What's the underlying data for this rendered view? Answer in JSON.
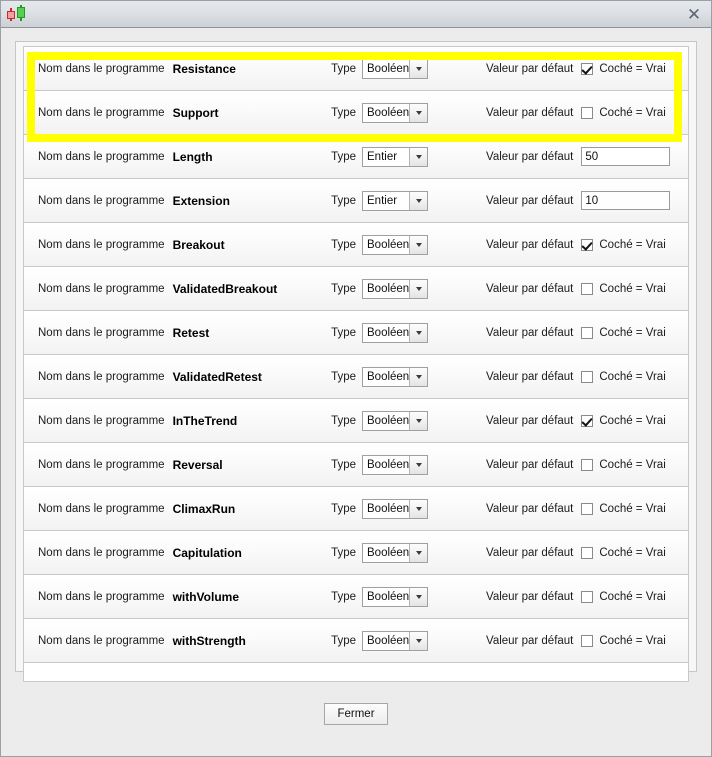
{
  "window": {
    "title": "",
    "icon": "candlestick-chart-icon",
    "close_label": "✕"
  },
  "labels": {
    "name_prefix": "Nom dans le programme",
    "type": "Type",
    "default_value": "Valeur par défaut",
    "checked_true": "Coché = Vrai"
  },
  "types": {
    "boolean": "Booléen",
    "integer": "Entier"
  },
  "highlight": {
    "color": "#ffff00",
    "covers_rows": [
      "Resistance",
      "Support"
    ]
  },
  "rows": [
    {
      "name": "Resistance",
      "type": "Booléen",
      "control": "checkbox",
      "checked": true,
      "value": ""
    },
    {
      "name": "Support",
      "type": "Booléen",
      "control": "checkbox",
      "checked": false,
      "value": ""
    },
    {
      "name": "Length",
      "type": "Entier",
      "control": "text",
      "checked": false,
      "value": "50"
    },
    {
      "name": "Extension",
      "type": "Entier",
      "control": "text",
      "checked": false,
      "value": "10"
    },
    {
      "name": "Breakout",
      "type": "Booléen",
      "control": "checkbox",
      "checked": true,
      "value": ""
    },
    {
      "name": "ValidatedBreakout",
      "type": "Booléen",
      "control": "checkbox",
      "checked": false,
      "value": ""
    },
    {
      "name": "Retest",
      "type": "Booléen",
      "control": "checkbox",
      "checked": false,
      "value": ""
    },
    {
      "name": "ValidatedRetest",
      "type": "Booléen",
      "control": "checkbox",
      "checked": false,
      "value": ""
    },
    {
      "name": "InTheTrend",
      "type": "Booléen",
      "control": "checkbox",
      "checked": true,
      "value": ""
    },
    {
      "name": "Reversal",
      "type": "Booléen",
      "control": "checkbox",
      "checked": false,
      "value": ""
    },
    {
      "name": "ClimaxRun",
      "type": "Booléen",
      "control": "checkbox",
      "checked": false,
      "value": ""
    },
    {
      "name": "Capitulation",
      "type": "Booléen",
      "control": "checkbox",
      "checked": false,
      "value": ""
    },
    {
      "name": "withVolume",
      "type": "Booléen",
      "control": "checkbox",
      "checked": false,
      "value": ""
    },
    {
      "name": "withStrength",
      "type": "Booléen",
      "control": "checkbox",
      "checked": false,
      "value": ""
    }
  ],
  "footer": {
    "close_button": "Fermer"
  }
}
